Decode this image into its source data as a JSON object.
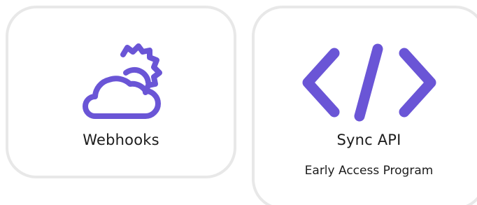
{
  "cards": [
    {
      "label": "Webhooks",
      "icon": "cloud-sun-gear-icon"
    },
    {
      "label": "Sync API",
      "sublabel": "Early Access Program",
      "icon": "code-icon"
    }
  ],
  "colors": {
    "accent": "#6a55d6",
    "card_border": "#e8e8e8",
    "text": "#1c1c1c"
  }
}
